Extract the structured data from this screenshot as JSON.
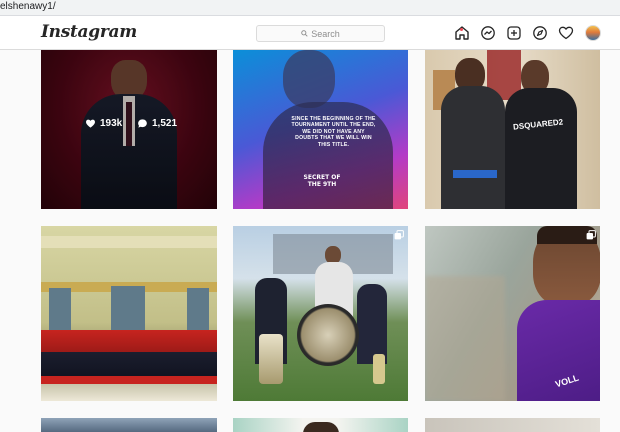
{
  "browser": {
    "url": "elshenawy1/"
  },
  "nav": {
    "logo": "Instagram",
    "search": {
      "placeholder": "Search"
    },
    "icons": [
      "home-icon",
      "messenger-icon",
      "new-post-icon",
      "explore-icon",
      "activity-heart-icon",
      "profile-avatar"
    ]
  },
  "posts": [
    {
      "likes": "193k",
      "comments": "1,521",
      "hovered": true,
      "type": "photo"
    },
    {
      "type": "photo",
      "caption": "SINCE THE BEGINNING OF THE TOURNAMENT UNTIL THE END, WE DID NOT HAVE ANY DOUBTS THAT WE WILL WIN THIS TITLE.",
      "badge": "SECRET OF THE 9TH"
    },
    {
      "type": "photo",
      "shirt_text": "DSQUARED2"
    },
    {
      "type": "photo"
    },
    {
      "type": "carousel"
    },
    {
      "type": "carousel"
    },
    {
      "type": "photo"
    },
    {
      "type": "photo"
    },
    {
      "type": "photo"
    }
  ],
  "colors": {
    "notification_dot": "#ed4956",
    "nav_border": "#dbdbdb",
    "page_bg": "#fafafa"
  }
}
